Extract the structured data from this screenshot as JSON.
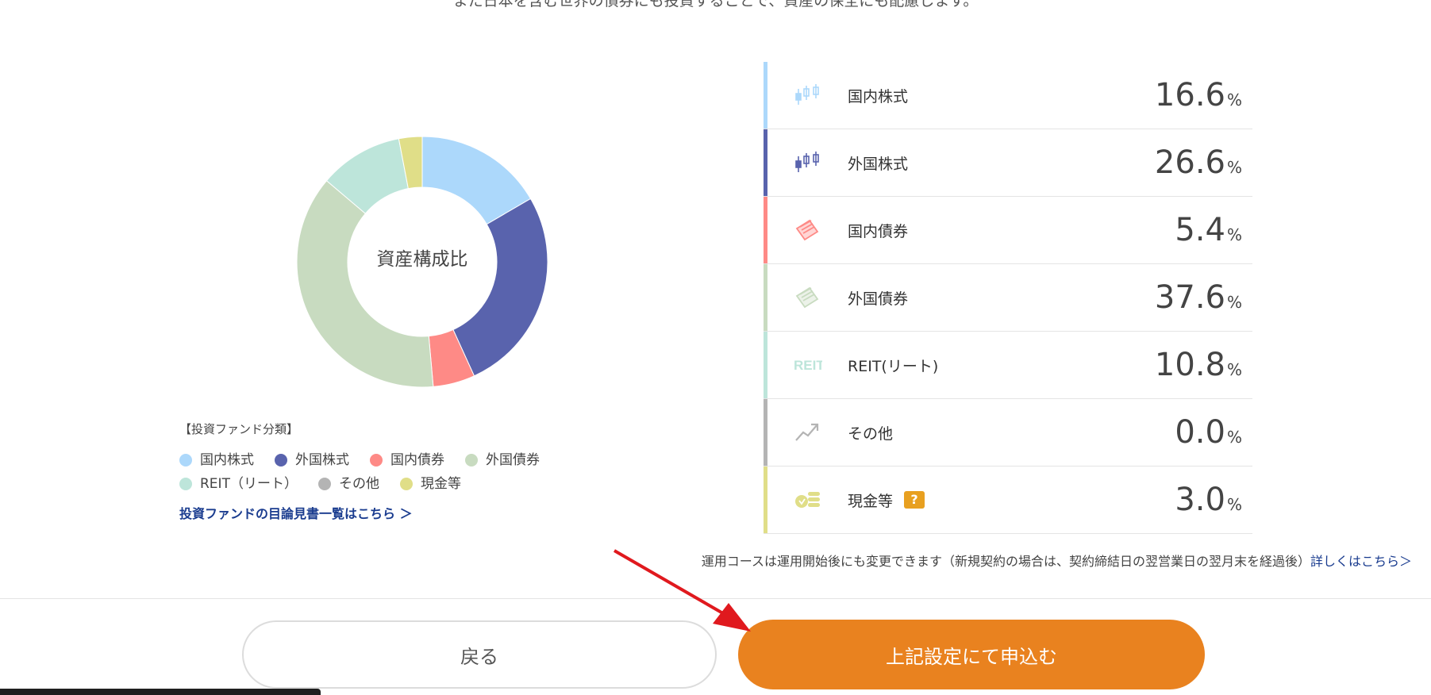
{
  "intro_text": "また日本を含む世界の債券にも投資することで、資産の保全にも配慮します。",
  "chart_data": {
    "type": "pie",
    "donut": true,
    "center_label": "資産構成比",
    "categories": [
      "国内株式",
      "外国株式",
      "国内債券",
      "外国債券",
      "REIT(リート)",
      "その他",
      "現金等"
    ],
    "values": [
      16.6,
      26.6,
      5.4,
      37.6,
      10.8,
      0.0,
      3.0
    ],
    "colors": [
      "#acd8fb",
      "#5963ad",
      "#fe8a86",
      "#c8dbc0",
      "#bde5da",
      "#b4b4b4",
      "#e0de88"
    ]
  },
  "legend": {
    "title": "【投資ファンド分類】",
    "items": [
      {
        "label": "国内株式",
        "color": "#acd8fb"
      },
      {
        "label": "外国株式",
        "color": "#5963ad"
      },
      {
        "label": "国内債券",
        "color": "#fe8a86"
      },
      {
        "label": "外国債券",
        "color": "#c8dbc0"
      },
      {
        "label": "REIT（リート）",
        "color": "#bde5da"
      },
      {
        "label": "その他",
        "color": "#b4b4b4"
      },
      {
        "label": "現金等",
        "color": "#e0de88"
      }
    ],
    "link": "投資ファンドの目論見書一覧はこちら ＞"
  },
  "allocation": [
    {
      "label": "国内株式",
      "value": "16.6",
      "unit": "%",
      "color": "#acd8fb",
      "icon": "candlestick-icon"
    },
    {
      "label": "外国株式",
      "value": "26.6",
      "unit": "%",
      "color": "#5963ad",
      "icon": "candlestick-icon"
    },
    {
      "label": "国内債券",
      "value": "5.4",
      "unit": "%",
      "color": "#fe8a86",
      "icon": "bond-paper-icon"
    },
    {
      "label": "外国債券",
      "value": "37.6",
      "unit": "%",
      "color": "#c8dbc0",
      "icon": "bond-paper-icon"
    },
    {
      "label": "REIT(リート)",
      "value": "10.8",
      "unit": "%",
      "color": "#bde5da",
      "icon": "reit-icon",
      "icon_text": "REIT"
    },
    {
      "label": "その他",
      "value": "0.0",
      "unit": "%",
      "color": "#b4b4b4",
      "icon": "trend-up-icon"
    },
    {
      "label": "現金等",
      "value": "3.0",
      "unit": "%",
      "color": "#e0de88",
      "icon": "coins-icon",
      "help": "?"
    }
  ],
  "note": {
    "text": "運用コースは運用開始後にも変更できます（新規契約の場合は、契約締結日の翌営業日の翌月末を経過後）",
    "link": "詳しくはこちら＞"
  },
  "buttons": {
    "back": "戻る",
    "apply": "上記設定にて申込む"
  }
}
